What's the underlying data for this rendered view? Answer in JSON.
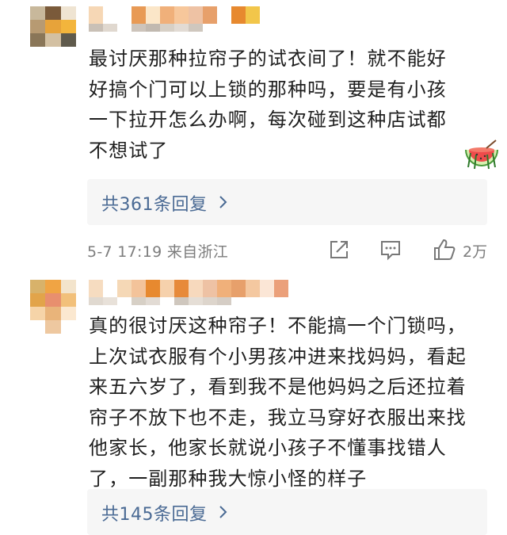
{
  "comments": [
    {
      "text": "最讨厌那种拉帘子的试衣间了！就不能好\n好搞个门可以上锁的那种吗，要是有小孩\n一下拉开怎么办啊，每次碰到这种店试都\n不想试了",
      "sticker": "watermelon-emoji",
      "reply_label": "共361条回复",
      "timestamp": "5-7 17:19",
      "location": "来自浙江",
      "like_count": "2万"
    },
    {
      "text": "真的很讨厌这种帘子！不能搞一个门锁吗，\n上次试衣服有个小男孩冲进来找妈妈，看起\n来五六岁了，看到我不是他妈妈之后还拉着\n帘子不放下也不走，我立马穿好衣服出来找\n他家长，他家长就说小孩子不懂事找错人\n了，一副那种我大惊小怪的样子",
      "reply_label": "共145条回复"
    }
  ],
  "icons": {
    "share": "share-icon",
    "comment": "comment-icon",
    "like": "thumbs-up-icon",
    "chevron": "chevron-right-icon"
  },
  "colors": {
    "reply_link": "#4a6a94",
    "meta_gray": "#7d7d7d",
    "reply_bg": "#f6f6f6"
  }
}
